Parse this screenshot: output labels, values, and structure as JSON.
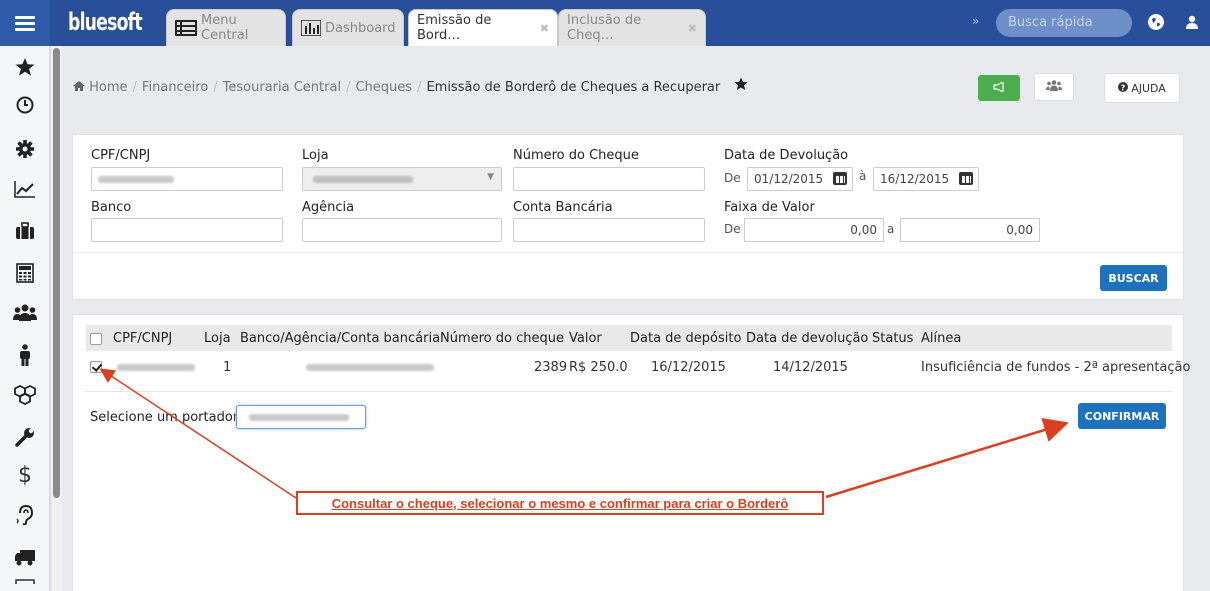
{
  "topbar": {
    "logo": "bluesoft",
    "tabs": [
      {
        "label": "Menu Central",
        "active": false,
        "closable": false
      },
      {
        "label": "Dashboard",
        "active": false,
        "closable": false
      },
      {
        "label": "Emissão de Bord…",
        "active": true,
        "closable": true
      },
      {
        "label": "Inclusão de Cheq…",
        "active": false,
        "closable": true
      }
    ],
    "search_placeholder": "Busca rápida",
    "chevron": "»"
  },
  "sidebar": {
    "icons": [
      "star-icon",
      "clock-icon",
      "gear-icon",
      "chart-icon",
      "briefcase-icon",
      "calculator-icon",
      "users-icon",
      "person-icon",
      "boxes-icon",
      "wrench-icon",
      "dollar-icon",
      "ear-icon",
      "truck-icon"
    ]
  },
  "breadcrumb": {
    "items": [
      "Home",
      "Financeiro",
      "Tesouraria Central",
      "Cheques"
    ],
    "current": "Emissão de Borderô de Cheques a Recuperar"
  },
  "header_actions": {
    "help_label": "AJUDA"
  },
  "filters": {
    "cpf_label": "CPF/CNPJ",
    "loja_label": "Loja",
    "numero_label": "Número do Cheque",
    "data_label": "Data de Devolução",
    "data_de": "De",
    "data_from": "01/12/2015",
    "data_a": "à",
    "data_to": "16/12/2015",
    "banco_label": "Banco",
    "agencia_label": "Agência",
    "conta_label": "Conta Bancária",
    "faixa_label": "Faixa de Valor",
    "faixa_de": "De",
    "faixa_from": "0,00",
    "faixa_a": "a",
    "faixa_to": "0,00",
    "buscar_label": "BUSCAR"
  },
  "table": {
    "headers": [
      "CPF/CNPJ",
      "Loja",
      "Banco/Agência/Conta bancária",
      "Número do cheque",
      "Valor",
      "Data de depósito",
      "Data de devolução",
      "Status",
      "Alínea"
    ],
    "rows": [
      {
        "loja": "1",
        "numero": "2389",
        "valor": "R$ 250.0",
        "deposito": "16/12/2015",
        "devolucao": "14/12/2015",
        "status": "",
        "alinea": "Insuficiência de fundos - 2ª apresentação",
        "checked": true
      }
    ]
  },
  "portador_label": "Selecione um portador:",
  "confirmar_label": "CONFIRMAR",
  "annotation": "Consultar o cheque, selecionar o mesmo e confirmar para criar o Borderô",
  "colors": {
    "topbar": "#2a4f9a",
    "primary": "#1e72bb",
    "success": "#4cae4c",
    "annotation": "#d9401f"
  }
}
